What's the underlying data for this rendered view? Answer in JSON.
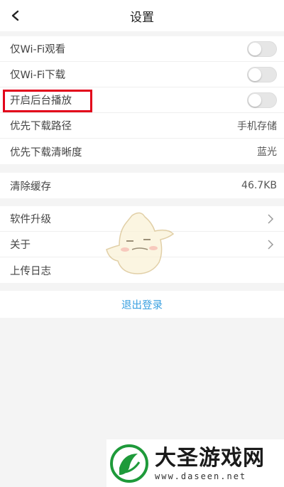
{
  "header": {
    "title": "设置",
    "back_icon": "back-chevron-icon"
  },
  "group1": [
    {
      "label": "仅Wi-Fi观看",
      "control": "toggle",
      "on": false
    },
    {
      "label": "仅Wi-Fi下载",
      "control": "toggle",
      "on": false
    },
    {
      "label": "开启后台播放",
      "control": "toggle",
      "on": false,
      "highlighted": true
    },
    {
      "label": "优先下载路径",
      "value": "手机存储"
    },
    {
      "label": "优先下载清晰度",
      "value": "蓝光"
    }
  ],
  "cache": {
    "label": "清除缓存",
    "value": "46.7KB"
  },
  "group3": [
    {
      "label": "软件升级",
      "icon": "chevron-right-icon"
    },
    {
      "label": "关于",
      "icon": "chevron-right-icon"
    },
    {
      "label": "上传日志"
    }
  ],
  "logout": {
    "label": "退出登录"
  },
  "watermark": {
    "name": "大圣游戏网",
    "url": "www.daseen.net"
  },
  "colors": {
    "accent": "#3aa0e0",
    "highlight": "#e2001a",
    "background": "#f4f4f4"
  }
}
